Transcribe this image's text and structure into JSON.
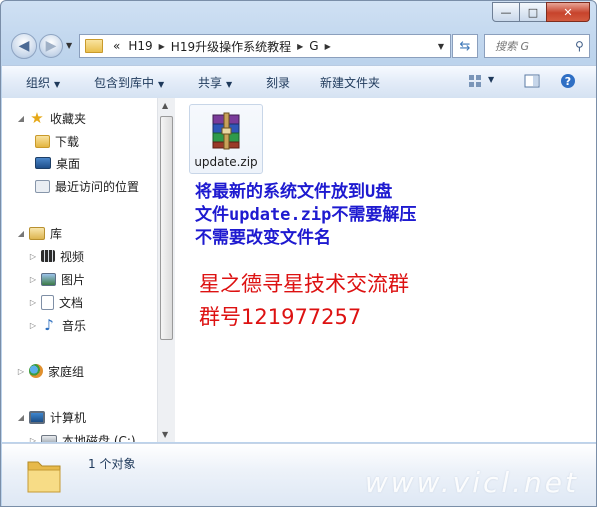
{
  "window": {
    "controls": {
      "minimize": "—",
      "maximize": "□",
      "close": "✕"
    }
  },
  "address": {
    "overflow": "«",
    "crumbs": [
      "H19",
      "H19升级操作系统教程",
      "G"
    ],
    "search_placeholder": "搜索 G"
  },
  "toolbar": {
    "organize": "组织",
    "include_in_library": "包含到库中",
    "share": "共享",
    "burn": "刻录",
    "new_folder": "新建文件夹"
  },
  "sidebar": {
    "favorites": {
      "label": "收藏夹",
      "items": [
        "下载",
        "桌面",
        "最近访问的位置"
      ]
    },
    "libraries": {
      "label": "库",
      "items": [
        "视频",
        "图片",
        "文档",
        "音乐"
      ]
    },
    "homegroup": {
      "label": "家庭组"
    },
    "computer": {
      "label": "计算机",
      "items": [
        "本地磁盘 (C:)"
      ]
    }
  },
  "file": {
    "name": "update.zip"
  },
  "notes": {
    "blue": [
      "将最新的系统文件放到U盘",
      "文件update.zip不需要解压",
      "不需要改变文件名"
    ],
    "red": [
      "星之德寻星技术交流群",
      "群号121977257"
    ]
  },
  "status": {
    "count": "1 个对象"
  },
  "watermark": "www.vicl.net"
}
